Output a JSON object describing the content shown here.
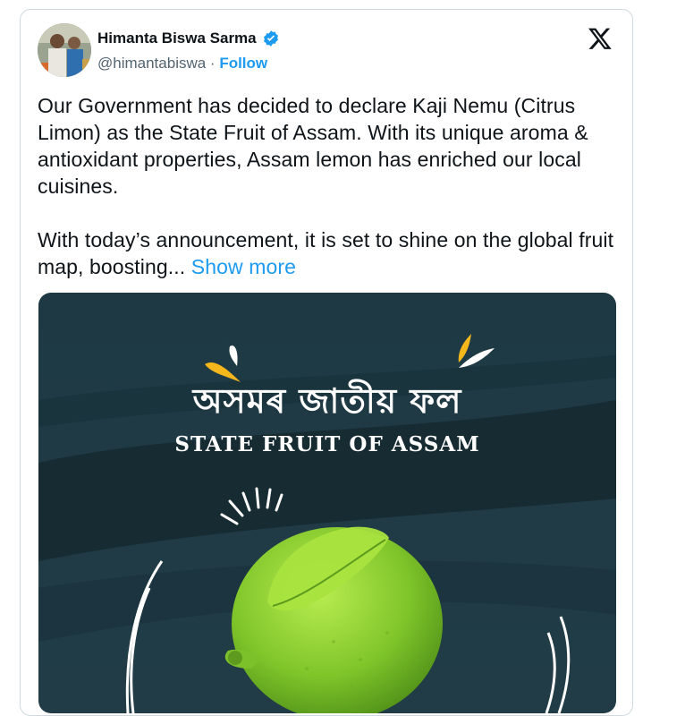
{
  "author": {
    "name": "Himanta Biswa Sarma",
    "handle": "@himantabiswa",
    "separator": " · ",
    "follow_label": "Follow",
    "verified": true
  },
  "tweet": {
    "paragraph1": "Our Government has decided to declare Kaji Nemu (Citrus Limon) as the State Fruit of Assam. With its unique aroma & antioxidant properties, Assam lemon has enriched our local cuisines.",
    "paragraph2": "With today’s announcement, it is set to shine on the global fruit map, boosting...",
    "show_more_label": "Show more"
  },
  "media": {
    "title_assamese": "অসমৰ জাতীয় ফল",
    "title_english": "STATE FRUIT OF ASSAM",
    "background_color": "#1f3a44",
    "accent_color": "#f5b81c",
    "lemon_color": "#8ccf2e"
  },
  "colors": {
    "link": "#1d9bf0",
    "text": "#0f1419",
    "muted": "#536471"
  },
  "icons": {
    "verified": "verified-badge-icon",
    "platform": "x-logo-icon"
  }
}
